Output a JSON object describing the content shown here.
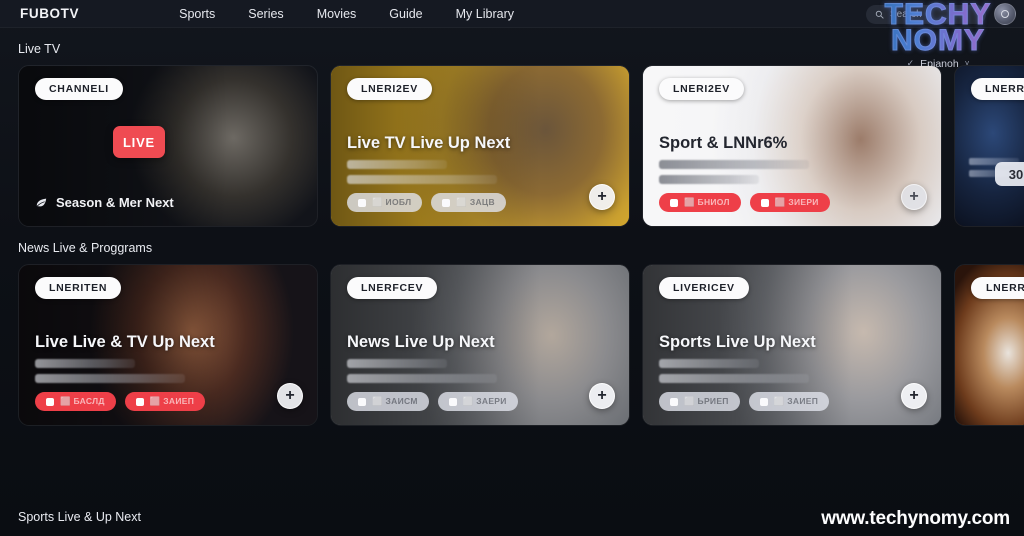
{
  "header": {
    "brand": "FUBOTV",
    "nav": [
      {
        "label": "Sports"
      },
      {
        "label": "Series"
      },
      {
        "label": "Movies"
      },
      {
        "label": "Guide"
      },
      {
        "label": "My Library"
      }
    ],
    "search": {
      "placeholder": "Search",
      "icon": "search-icon"
    },
    "avatar_icon": "user-avatar-icon"
  },
  "watermark": {
    "logo_line1": "TECHY",
    "logo_line2": "NOMY",
    "sublabel": "Epianoh",
    "sub_icon": "check-icon",
    "chevron": "˅",
    "url": "www.techynomy.com"
  },
  "sections": [
    {
      "title": "Live TV",
      "cards": [
        {
          "badge": "CHANNELI",
          "chip": "LIVE",
          "caption": "Season & Mer Next",
          "caption_icon": "leaf-icon",
          "style": "dark",
          "kind": "caption"
        },
        {
          "badge": "LNERI2EV",
          "title": "Live TV Live Up Next",
          "subtitle_1": "Foots Tioccio uLic> clas",
          "subtitle_2": "Puolotnoe.hoeo'y.Bocskietiee",
          "pills": [
            {
              "label": "⬜ ИОБЛ",
              "color": "light"
            },
            {
              "label": "⬜ ЗАЦВ",
              "color": "light"
            }
          ],
          "plus": "+",
          "style": "amber",
          "kind": "standard"
        },
        {
          "badge": "LNERI2EV",
          "title": "Sport & LNNr6%",
          "subtitle_1": "Portiesren Yos Iraetees Yoa DLE",
          "subtitle_2": "hoex ins",
          "pills": [
            {
              "label": "⬜ БНИОЛ",
              "color": "red"
            },
            {
              "label": "⬜ ЗИЕРИ",
              "color": "red"
            }
          ],
          "plus": "+",
          "style": "light",
          "kind": "standard-dark-text"
        },
        {
          "badge": "LNERRW",
          "num_pill": "30",
          "style": "navy",
          "kind": "partial"
        }
      ]
    },
    {
      "title": "News Live & Proggrams",
      "cards": [
        {
          "badge": "LNERITEN",
          "title": "Live Live & TV Up Next",
          "subtitle_1": "Pood Otnoisv",
          "subtitle_2": "ProleinoiNigaceiW Noeciure",
          "pills": [
            {
              "label": "⬜ БАСЛД",
              "color": "red"
            },
            {
              "label": "⬜ ЗАИЕП",
              "color": "red"
            }
          ],
          "plus": "+",
          "style": "drama",
          "kind": "standard"
        },
        {
          "badge": "LNERFCEV",
          "title": "News Live Up Next",
          "subtitle_1": "Reto hopre oohe",
          "subtitle_2": "PvolemoiN Gecerk Kbecinrs",
          "pills": [
            {
              "label": "⬜ ЗАИСМ",
              "color": "light"
            },
            {
              "label": "⬜ ЗАЕРИ",
              "color": "light"
            }
          ],
          "plus": "+",
          "style": "gray",
          "kind": "standard"
        },
        {
          "badge": "LIVERICEV",
          "title": "Sports Live Up Next",
          "subtitle_1": "Pomv hopte",
          "subtitle_2": "PuclenisiNiBaceit iWoe ciors",
          "pills": [
            {
              "label": "⬜ ЬРИЕП",
              "color": "light"
            },
            {
              "label": "⬜ ЗАИЕП",
              "color": "light"
            }
          ],
          "plus": "+",
          "style": "graysilver",
          "kind": "standard"
        },
        {
          "badge": "LNERRC",
          "style": "copper",
          "kind": "partial-plain"
        }
      ]
    }
  ],
  "bottom_section": {
    "title": "Sports Live & Up Next"
  },
  "colors": {
    "page_bg": "#0e1117",
    "topbar_bg": "#151922",
    "accent_red": "#ee3f48",
    "live_chip": "#ef4b52",
    "badge_bg": "#fbfbfc",
    "amber": "#e8b62a"
  }
}
